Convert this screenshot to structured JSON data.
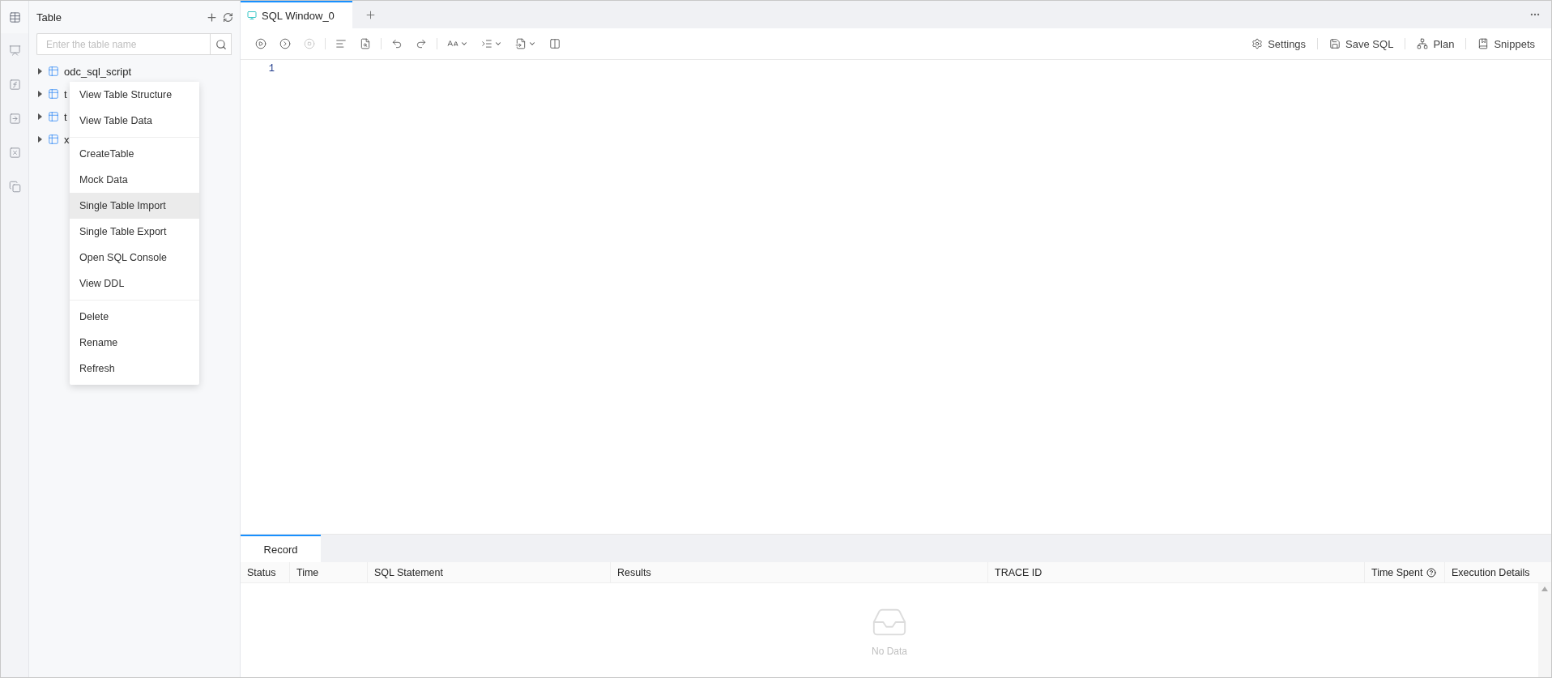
{
  "rail": [
    {
      "kind": "table",
      "selected": true
    },
    {
      "kind": "view",
      "selected": false
    },
    {
      "kind": "function",
      "selected": false
    },
    {
      "kind": "procedure",
      "selected": false
    },
    {
      "kind": "trigger",
      "selected": false
    },
    {
      "kind": "sequence",
      "selected": false
    }
  ],
  "sidebar": {
    "title": "Table",
    "search": {
      "placeholder": "Enter the table name"
    },
    "items": [
      {
        "label": "odc_sql_script",
        "expanded": false
      },
      {
        "label": "t",
        "expanded": false
      },
      {
        "label": "t",
        "expanded": false
      },
      {
        "label": "x",
        "expanded": false
      }
    ]
  },
  "context_menu": [
    [
      {
        "label": "View Table Structure",
        "highlighted": false
      },
      {
        "label": "View Table Data",
        "highlighted": false
      }
    ],
    [
      {
        "label": "CreateTable",
        "highlighted": false
      },
      {
        "label": "Mock Data",
        "highlighted": false
      },
      {
        "label": "Single Table Import",
        "highlighted": true
      },
      {
        "label": "Single Table Export",
        "highlighted": false
      },
      {
        "label": "Open SQL Console",
        "highlighted": false
      },
      {
        "label": "View DDL",
        "highlighted": false
      }
    ],
    [
      {
        "label": "Delete",
        "highlighted": false
      },
      {
        "label": "Rename",
        "highlighted": false
      },
      {
        "label": "Refresh",
        "highlighted": false
      }
    ]
  ],
  "tabs": [
    {
      "label": "SQL Window_0",
      "selected": true
    }
  ],
  "toolbar": [
    {
      "kind": "run",
      "disabled": false
    },
    {
      "kind": "run-current",
      "disabled": false
    },
    {
      "kind": "stop",
      "disabled": true
    },
    {
      "kind": "sep"
    },
    {
      "kind": "format",
      "disabled": false
    },
    {
      "kind": "find",
      "disabled": false
    },
    {
      "kind": "sep"
    },
    {
      "kind": "undo",
      "disabled": false
    },
    {
      "kind": "redo",
      "disabled": false
    },
    {
      "kind": "sep"
    },
    {
      "kind": "font-size",
      "disabled": false
    },
    {
      "kind": "indent",
      "disabled": false
    },
    {
      "kind": "file",
      "disabled": false
    },
    {
      "kind": "columns",
      "disabled": false
    }
  ],
  "toolbar_right": [
    {
      "kind": "settings",
      "label": "Settings"
    },
    {
      "kind": "save",
      "label": "Save SQL"
    },
    {
      "kind": "plan",
      "label": "Plan"
    },
    {
      "kind": "snippets",
      "label": "Snippets"
    }
  ],
  "editor": {
    "line_numbers": [
      "1"
    ]
  },
  "result_tabs": [
    {
      "label": "Record",
      "selected": true
    }
  ],
  "record_table": {
    "columns": [
      {
        "label": "Status"
      },
      {
        "label": "Time"
      },
      {
        "label": "SQL Statement"
      },
      {
        "label": "Results"
      },
      {
        "label": "TRACE ID"
      },
      {
        "label": "Time Spent",
        "help": true
      },
      {
        "label": "Execution Details"
      }
    ],
    "empty_text": "No Data"
  }
}
